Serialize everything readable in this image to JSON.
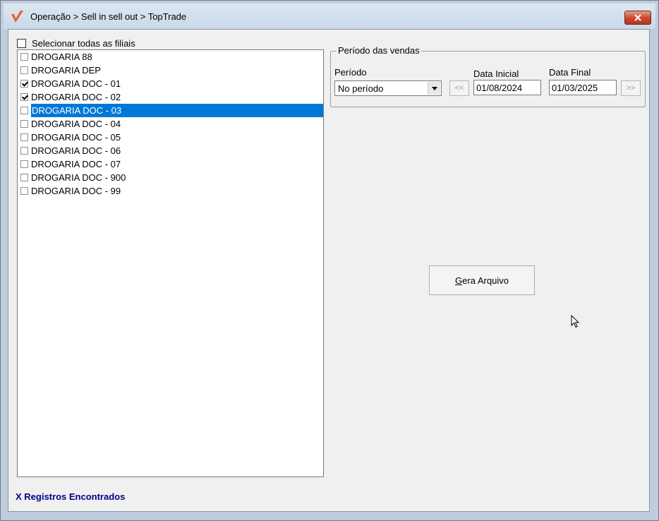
{
  "window": {
    "title": "Operação > Sell in sell out > TopTrade"
  },
  "branches": {
    "select_all_label": "Selecionar todas as filiais",
    "select_all_checked": false,
    "items": [
      {
        "label": "DROGARIA 88",
        "checked": false,
        "selected": false
      },
      {
        "label": "DROGARIA DEP",
        "checked": false,
        "selected": false
      },
      {
        "label": "DROGARIA DOC - 01",
        "checked": true,
        "selected": false
      },
      {
        "label": "DROGARIA DOC - 02",
        "checked": true,
        "selected": false
      },
      {
        "label": "DROGARIA DOC - 03",
        "checked": false,
        "selected": true
      },
      {
        "label": "DROGARIA DOC - 04",
        "checked": false,
        "selected": false
      },
      {
        "label": "DROGARIA DOC - 05",
        "checked": false,
        "selected": false
      },
      {
        "label": "DROGARIA DOC - 06",
        "checked": false,
        "selected": false
      },
      {
        "label": "DROGARIA DOC - 07",
        "checked": false,
        "selected": false
      },
      {
        "label": "DROGARIA DOC - 900",
        "checked": false,
        "selected": false
      },
      {
        "label": "DROGARIA DOC - 99",
        "checked": false,
        "selected": false
      }
    ]
  },
  "period": {
    "group_title": "Período das vendas",
    "period_label": "Período",
    "period_value": "No período",
    "prev_label": "<<",
    "next_label": ">>",
    "start_label": "Data Inicial",
    "start_value": "01/08/2024",
    "end_label": "Data Final",
    "end_value": "01/03/2025"
  },
  "actions": {
    "generate_mnemonic": "G",
    "generate_rest": "era Arquivo"
  },
  "status": {
    "text": "X Registros Encontrados"
  },
  "colors": {
    "selection": "#0078d7",
    "status_text": "#00008b",
    "close_button": "#c8452f"
  }
}
